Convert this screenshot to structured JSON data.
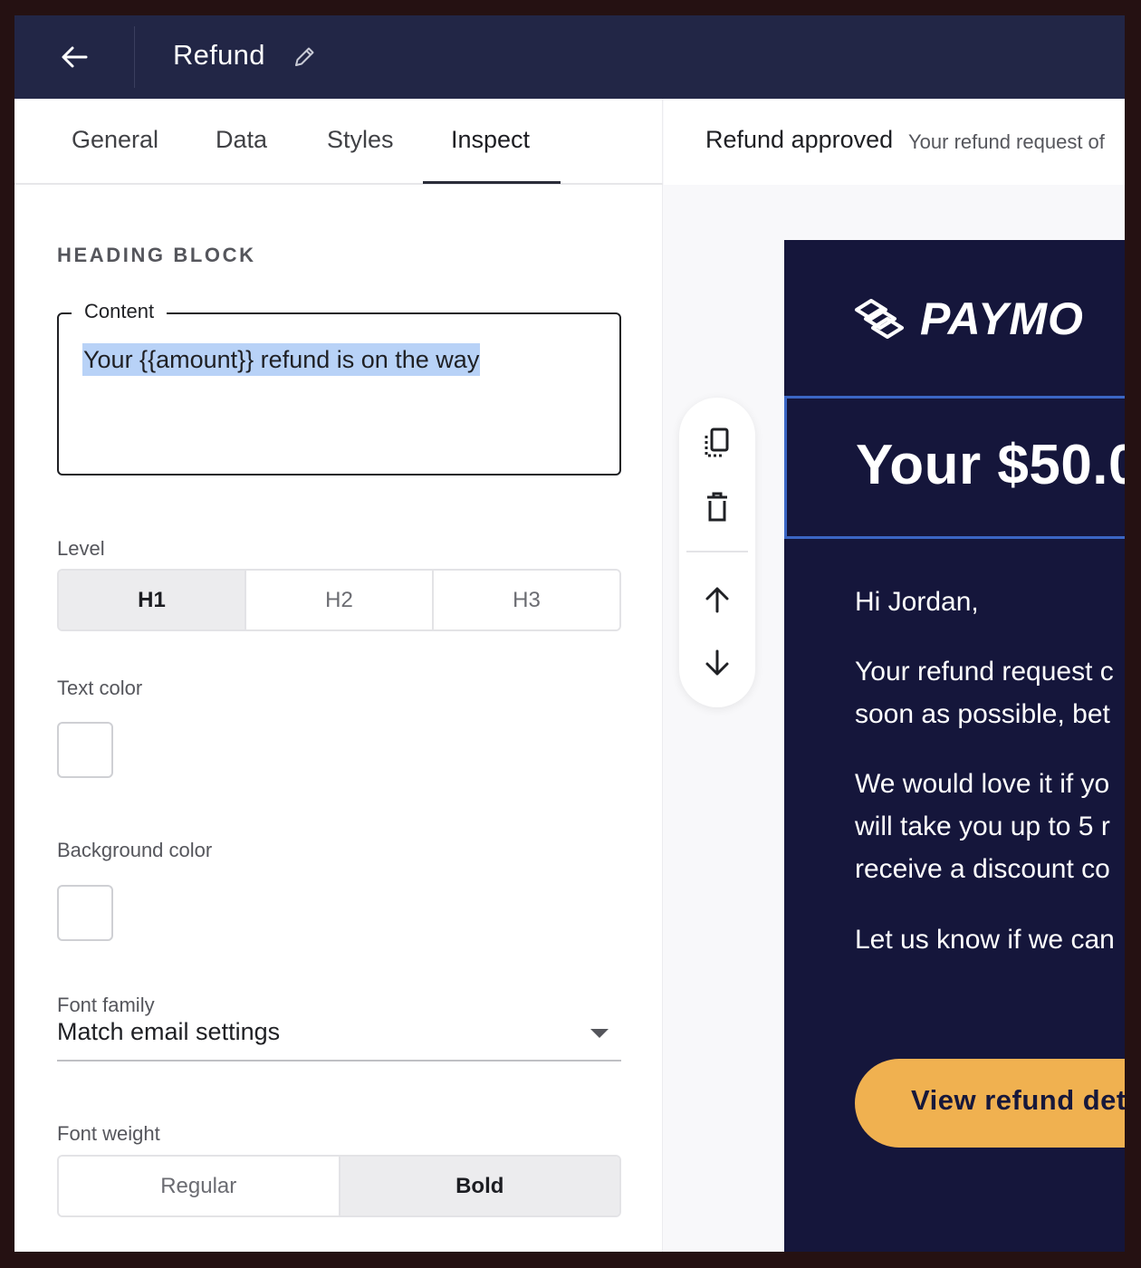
{
  "header": {
    "title": "Refund"
  },
  "tabs": [
    {
      "label": "General"
    },
    {
      "label": "Data"
    },
    {
      "label": "Styles"
    },
    {
      "label": "Inspect"
    }
  ],
  "inspect": {
    "section_title": "HEADING BLOCK",
    "content_label": "Content",
    "content_value": "Your {{amount}} refund is on the way",
    "level_label": "Level",
    "level_options": [
      "H1",
      "H2",
      "H3"
    ],
    "level_selected": "H1",
    "text_color_label": "Text color",
    "background_color_label": "Background color",
    "font_family_label": "Font family",
    "font_family_value": "Match email settings",
    "font_weight_label": "Font weight",
    "font_weight_options": [
      "Regular",
      "Bold"
    ],
    "font_weight_selected": "Bold"
  },
  "preview": {
    "subject": "Refund approved",
    "preheader": "Your refund request of",
    "logo_text": "PAYMO",
    "heading": "Your $50.0",
    "greeting": "Hi Jordan,",
    "paragraph1": [
      "Your refund request c",
      "soon as possible, bet"
    ],
    "paragraph2": [
      "We would love it if yo",
      "will take you up to 5 r",
      "receive a discount co"
    ],
    "paragraph3": "Let us know if we can",
    "cta_label": "View refund det"
  },
  "colors": {
    "topbar": "#222646",
    "email_background": "#15163b",
    "cta": "#f0b150",
    "selection_highlight": "#b8d2f7",
    "selected_block_outline": "#3b66c4"
  }
}
